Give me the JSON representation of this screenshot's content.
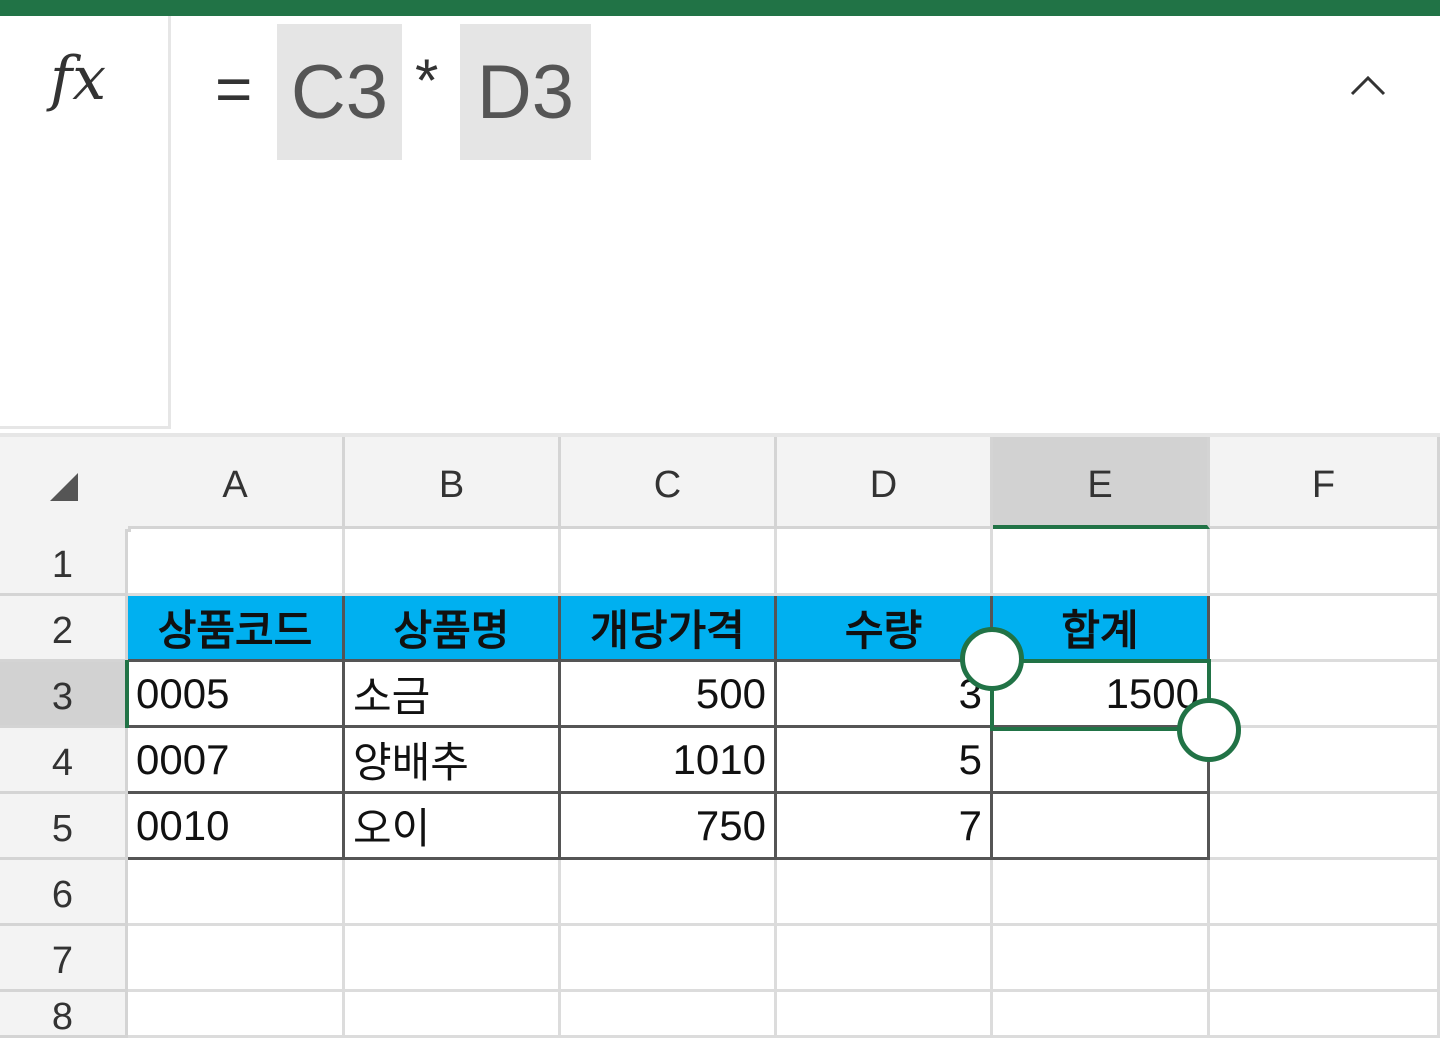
{
  "formula_bar": {
    "fx_label": "fx",
    "equals": "=",
    "ref1": "C3",
    "operator": "*",
    "ref2": "D3",
    "collapse_icon": "chevron-up-icon"
  },
  "columns": [
    "A",
    "B",
    "C",
    "D",
    "E",
    "F"
  ],
  "selected_column": "E",
  "rows": [
    "1",
    "2",
    "3",
    "4",
    "5",
    "6",
    "7",
    "8"
  ],
  "selected_row": "3",
  "table": {
    "headers": [
      "상품코드",
      "상품명",
      "개당가격",
      "수량",
      "합계"
    ],
    "rows": [
      [
        "0005",
        "소금",
        "500",
        "3",
        "1500"
      ],
      [
        "0007",
        "양배추",
        "1010",
        "5",
        ""
      ],
      [
        "0010",
        "오이",
        "750",
        "7",
        ""
      ]
    ]
  },
  "colors": {
    "accent": "#217346",
    "header_fill": "#00b0f0"
  }
}
